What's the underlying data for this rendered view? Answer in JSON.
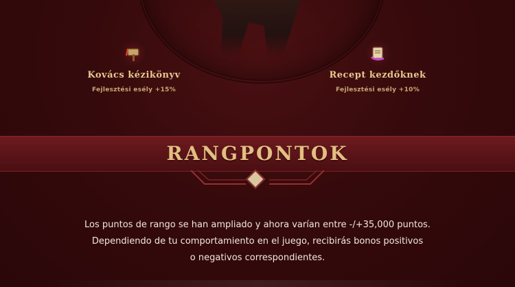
{
  "perks": [
    {
      "icon": "hammer-icon",
      "title": "Kovács kézikönyv",
      "bonus": "Fejlesztési esély +15%"
    },
    {
      "icon": "scroll-icon",
      "title": "Recept kezdőknek",
      "bonus": "Fejlesztési esély +10%"
    }
  ],
  "section": {
    "title": "RANGPONTOK"
  },
  "description": {
    "line1": "Los puntos de rango se han ampliado y ahora varían entre -/+35,000 puntos.",
    "line2": "Dependiendo de tu comportamiento en el juego, recibirás bonos positivos",
    "line3": "o negativos correspondientes."
  }
}
